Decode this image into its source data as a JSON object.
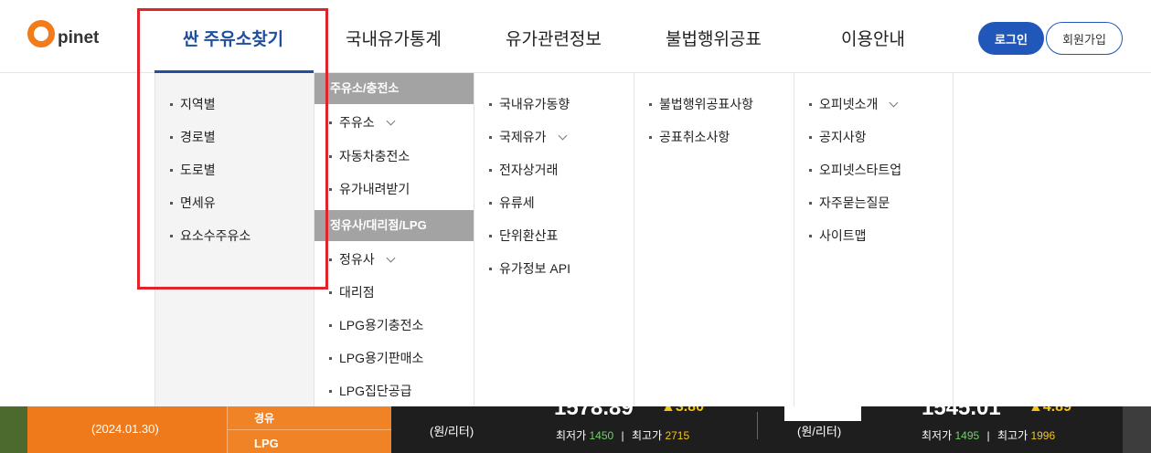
{
  "brand": {
    "logo_text": "pinet",
    "accent": "#f07c1c"
  },
  "nav": {
    "items": [
      {
        "label": "싼 주유소찾기",
        "active": true
      },
      {
        "label": "국내유가통계"
      },
      {
        "label": "유가관련정보"
      },
      {
        "label": "불법행위공표"
      },
      {
        "label": "이용안내"
      }
    ],
    "login": "로그인",
    "join": "회원가입"
  },
  "menu": {
    "col1": [
      "지역별",
      "경로별",
      "도로별",
      "면세유",
      "요소수주유소"
    ],
    "col2_section1": "주유소/충전소",
    "col2_group1": [
      "주유소",
      "자동차충전소",
      "유가내려받기"
    ],
    "col2_section2": "정유사/대리점/LPG",
    "col2_group2": [
      "정유사",
      "대리점",
      "LPG용기충전소",
      "LPG용기판매소",
      "LPG집단공급"
    ],
    "col3": [
      "국내유가동향",
      "국제유가",
      "전자상거래",
      "유류세",
      "단위환산표",
      "유가정보 API"
    ],
    "col4": [
      "불법행위공표사항",
      "공표취소사항"
    ],
    "col5": [
      "오피넷소개",
      "공지사항",
      "오피넷스타트업",
      "자주묻는질문",
      "사이트맵"
    ]
  },
  "ticker": {
    "date": "(2024.01.30)",
    "fuel1": "경유",
    "fuel2": "LPG",
    "unit": "(원/리터)",
    "left_price": "1578.89",
    "left_change": "▲3.80",
    "left_min_label": "최저가",
    "left_min": "1450",
    "left_max_label": "최고가",
    "left_max": "2715",
    "right_price": "1545.01",
    "right_change": "▲4.89",
    "right_min_label": "최저가",
    "right_min": "1495",
    "right_max_label": "최고가",
    "right_max": "1996",
    "separator": "|"
  },
  "colors": {
    "nav_active": "#1f4f9e",
    "login_bg": "#2057b8",
    "highlight": "#e0242b",
    "ticker_orange": "#ef7a1b"
  }
}
